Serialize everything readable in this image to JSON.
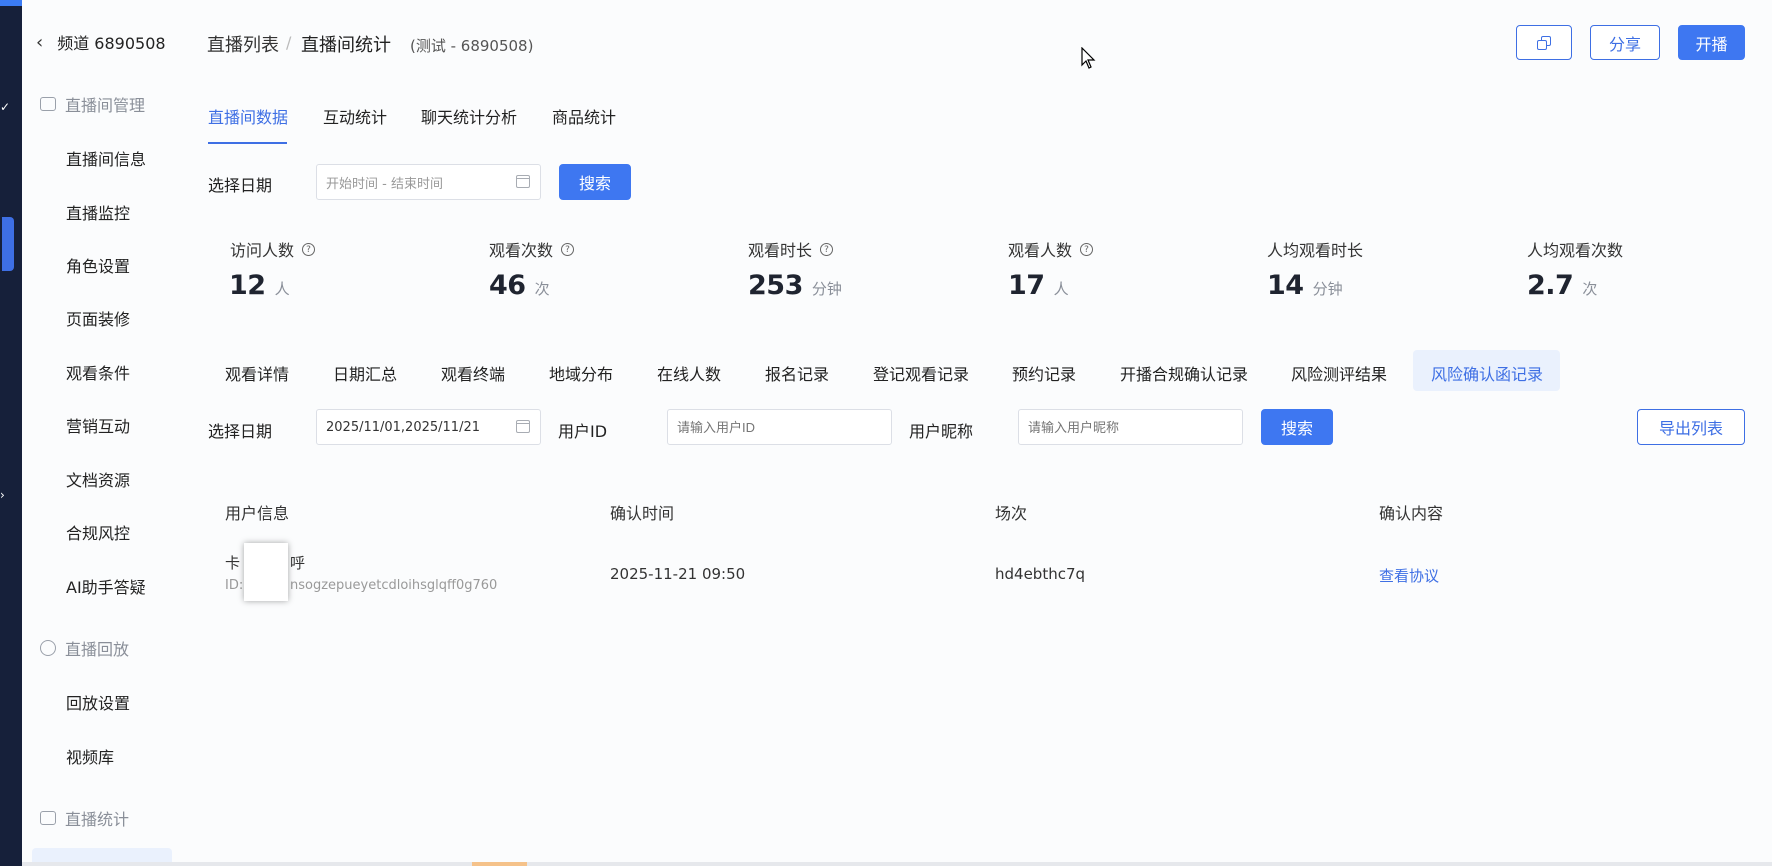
{
  "sidebar": {
    "channel": "频道 6890508",
    "groups": [
      {
        "title": "直播间管理",
        "items": [
          "直播间信息",
          "直播监控",
          "角色设置",
          "页面装修",
          "观看条件",
          "营销互动",
          "文档资源",
          "合规风控",
          "AI助手答疑"
        ]
      },
      {
        "title": "直播回放",
        "items": [
          "回放设置",
          "视频库"
        ]
      },
      {
        "title": "直播统计",
        "items": []
      }
    ]
  },
  "header": {
    "crumb_list": "直播列表",
    "separator": "/",
    "crumb_current": "直播间统计",
    "room_name": "(测试 - 6890508)",
    "share": "分享",
    "start": "开播"
  },
  "tabs": [
    "直播间数据",
    "互动统计",
    "聊天统计分析",
    "商品统计"
  ],
  "date_filter": {
    "label": "选择日期",
    "placeholder": "开始时间 - 结束时间",
    "search": "搜索"
  },
  "stats": [
    {
      "label": "访问人数",
      "value": "12",
      "unit": "人",
      "help": true
    },
    {
      "label": "观看次数",
      "value": "46",
      "unit": "次",
      "help": true
    },
    {
      "label": "观看时长",
      "value": "253",
      "unit": "分钟",
      "help": true
    },
    {
      "label": "观看人数",
      "value": "17",
      "unit": "人",
      "help": true
    },
    {
      "label": "人均观看时长",
      "value": "14",
      "unit": "分钟",
      "help": false
    },
    {
      "label": "人均观看次数",
      "value": "2.7",
      "unit": "次",
      "help": false
    }
  ],
  "subtabs": [
    "观看详情",
    "日期汇总",
    "观看终端",
    "地域分布",
    "在线人数",
    "报名记录",
    "登记观看记录",
    "预约记录",
    "开播合规确认记录",
    "风险测评结果",
    "风险确认函记录"
  ],
  "filter": {
    "date_label": "选择日期",
    "date_value": "2025/11/01,2025/11/21",
    "uid_label": "用户ID",
    "uid_placeholder": "请输入用户ID",
    "nick_label": "用户昵称",
    "nick_placeholder": "请输入用户昵称",
    "search": "搜索",
    "export": "导出列表"
  },
  "table": {
    "headers": [
      "用户信息",
      "确认时间",
      "场次",
      "确认内容"
    ],
    "rows": [
      {
        "name_start": "卡",
        "name_end": "呼",
        "id_prefix": "ID:",
        "id_visible": "nsogzepueyetcdloihsglqff0g760",
        "time": "2025-11-21 09:50",
        "session": "hd4ebthc7q",
        "content": "查看协议"
      }
    ]
  }
}
